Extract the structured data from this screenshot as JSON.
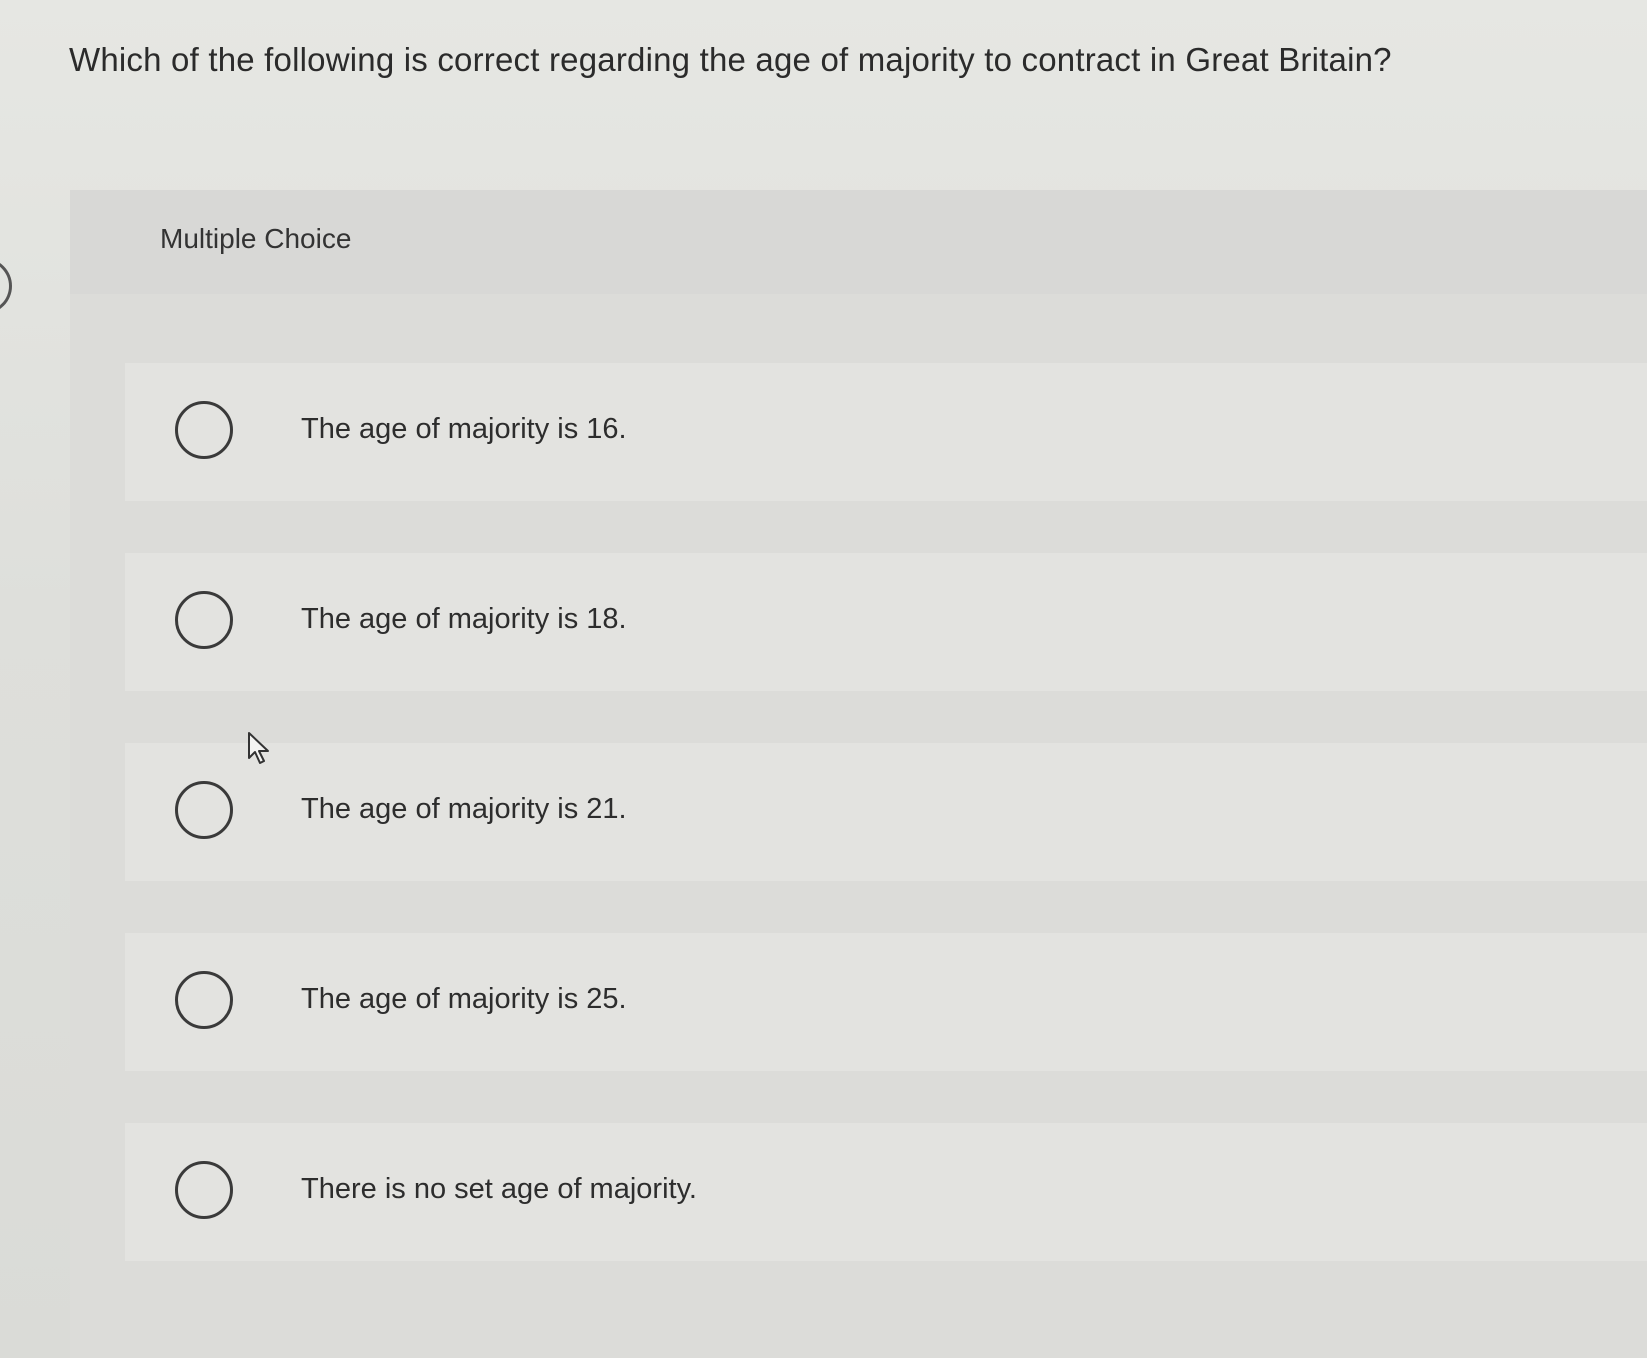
{
  "question": {
    "text": "Which of the following is correct regarding the age of majority to contract in Great Britain?"
  },
  "card": {
    "type_label": "Multiple Choice"
  },
  "options": [
    {
      "label": "The age of majority is 16.",
      "selected": false
    },
    {
      "label": "The age of majority is 18.",
      "selected": false
    },
    {
      "label": "The age of majority is 21.",
      "selected": false
    },
    {
      "label": "The age of majority is 25.",
      "selected": false
    },
    {
      "label": "There is no set age of majority.",
      "selected": false
    }
  ],
  "cursor": {
    "icon": "pointer-arrow-icon"
  }
}
